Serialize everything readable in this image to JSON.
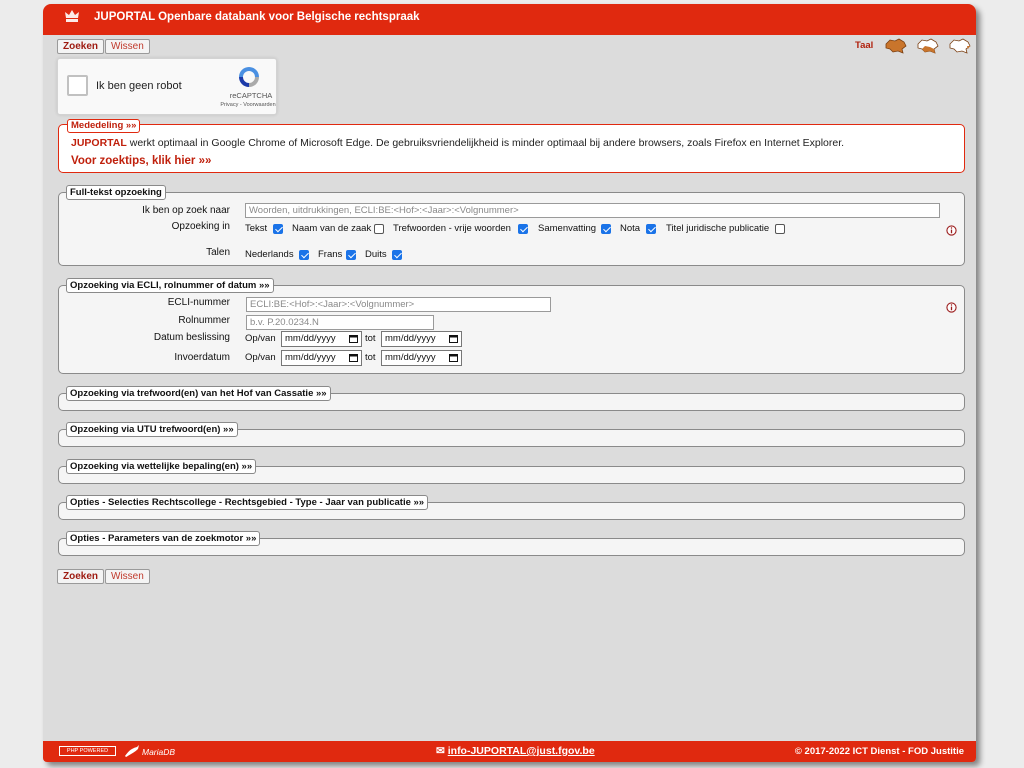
{
  "header": {
    "title": "JUPORTAL Openbare databank voor Belgische rechtspraak"
  },
  "top_buttons": {
    "search": "Zoeken",
    "clear": "Wissen"
  },
  "language": {
    "label": "Taal",
    "options": [
      "map-nl-icon",
      "map-fr-icon",
      "map-de-icon"
    ]
  },
  "captcha": {
    "label": "Ik ben geen robot",
    "brand": "reCAPTCHA",
    "links": "Privacy - Voorwaarden"
  },
  "notice": {
    "legend": "Mededeling  »»",
    "brand": "JUPORTAL",
    "message": " werkt optimaal in Google Chrome of Microsoft Edge. De gebruiksvriendelijkheid is minder optimaal bij andere browsers, zoals Firefox en Internet Explorer.",
    "tips": "Voor zoektips, klik hier »»"
  },
  "fulltext": {
    "legend": "Full-tekst opzoeking",
    "search_label": "Ik ben op zoek naar",
    "search_placeholder": "Woorden, uitdrukkingen, ECLI:BE:<Hof>:<Jaar>:<Volgnummer>",
    "search_value": "",
    "in_label": "Opzoeking in",
    "in_options": [
      {
        "label": "Tekst",
        "checked": true
      },
      {
        "label": "Naam van de zaak",
        "checked": false
      },
      {
        "label": "Trefwoorden - vrije woorden",
        "checked": true
      },
      {
        "label": "Samenvatting",
        "checked": true
      },
      {
        "label": "Nota",
        "checked": true
      },
      {
        "label": "Titel juridische publicatie",
        "checked": false
      }
    ],
    "lang_label": "Talen",
    "lang_options": [
      {
        "label": "Nederlands",
        "checked": true
      },
      {
        "label": "Frans",
        "checked": true
      },
      {
        "label": "Duits",
        "checked": true
      }
    ]
  },
  "ecli": {
    "legend": "Opzoeking via ECLI, rolnummer of datum »»",
    "ecli_label": "ECLI-nummer",
    "ecli_placeholder": "ECLI:BE:<Hof>:<Jaar>:<Volgnummer>",
    "rol_label": "Rolnummer",
    "rol_placeholder": "b.v. P.20.0234.N",
    "datum_label": "Datum beslissing",
    "invoer_label": "Invoerdatum",
    "from_label": "Op/van",
    "to_label": "tot",
    "date_placeholder": "mm/dd/yyyy"
  },
  "collapsed_sections": [
    "Opzoeking via trefwoord(en) van het Hof van Cassatie »»",
    "Opzoeking via UTU trefwoord(en) »»",
    "Opzoeking via wettelijke bepaling(en) »»",
    "Opties - Selecties Rechtscollege - Rechtsgebied - Type - Jaar van publicatie »»",
    "Opties - Parameters van de zoekmotor »»"
  ],
  "bottom_buttons": {
    "search": "Zoeken",
    "clear": "Wissen"
  },
  "footer": {
    "php": "PHP POWERED",
    "maria": "MariaDB",
    "email": "info-JUPORTAL@just.fgov.be",
    "copyright": "©  2017-2022 ICT Dienst - FOD Justitie"
  },
  "colors": {
    "brand_red": "#e0290f",
    "checkbox_blue": "#1a73e8"
  }
}
